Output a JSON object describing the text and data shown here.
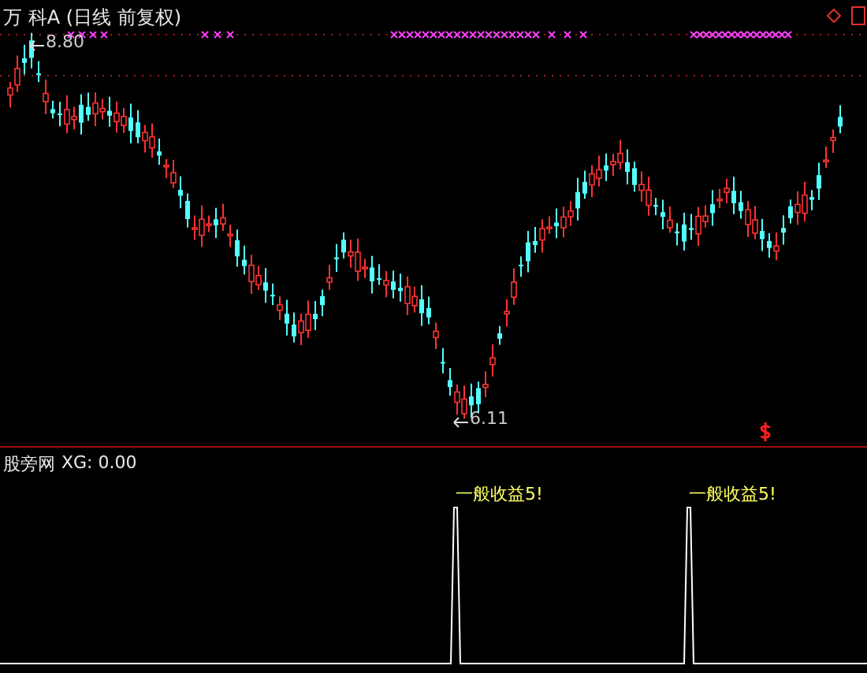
{
  "main_chart": {
    "title": "万 科A (日线 前复权)",
    "high_label": "8.80",
    "low_label": "6.11"
  },
  "indicator": {
    "name": "股旁网",
    "reading": "XG: 0.00",
    "signals": [
      {
        "label": "一般收益5!"
      },
      {
        "label": "一般收益5!"
      }
    ]
  }
}
